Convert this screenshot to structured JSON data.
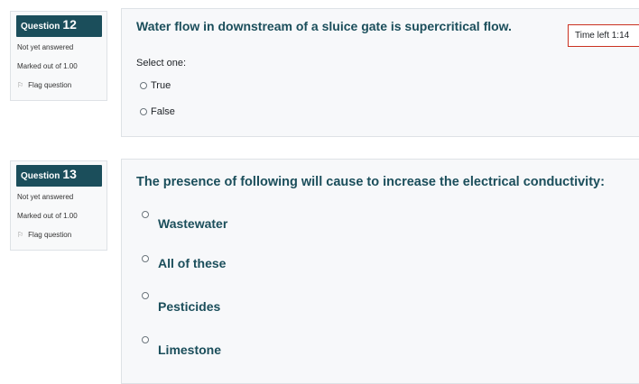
{
  "q12": {
    "label": "Question",
    "number": "12",
    "status": "Not yet answered",
    "marks": "Marked out of 1.00",
    "flag": "Flag question",
    "text": "Water flow in downstream of a sluice gate is supercritical flow.",
    "select_one": "Select one:",
    "options": [
      "True",
      "False"
    ]
  },
  "q13": {
    "label": "Question",
    "number": "13",
    "status": "Not yet answered",
    "marks": "Marked out of 1.00",
    "flag": "Flag question",
    "text": "The presence of following will cause to increase the electrical conductivity:",
    "options": [
      "Wastewater",
      "All of these",
      "Pesticides",
      "Limestone"
    ]
  },
  "timer": {
    "text": "Time left 1:14"
  },
  "colors": {
    "accent": "#1b4e5b",
    "timer_border": "#ca3120"
  },
  "icons": {
    "flag": "flag-icon",
    "radio": "radio-button"
  }
}
